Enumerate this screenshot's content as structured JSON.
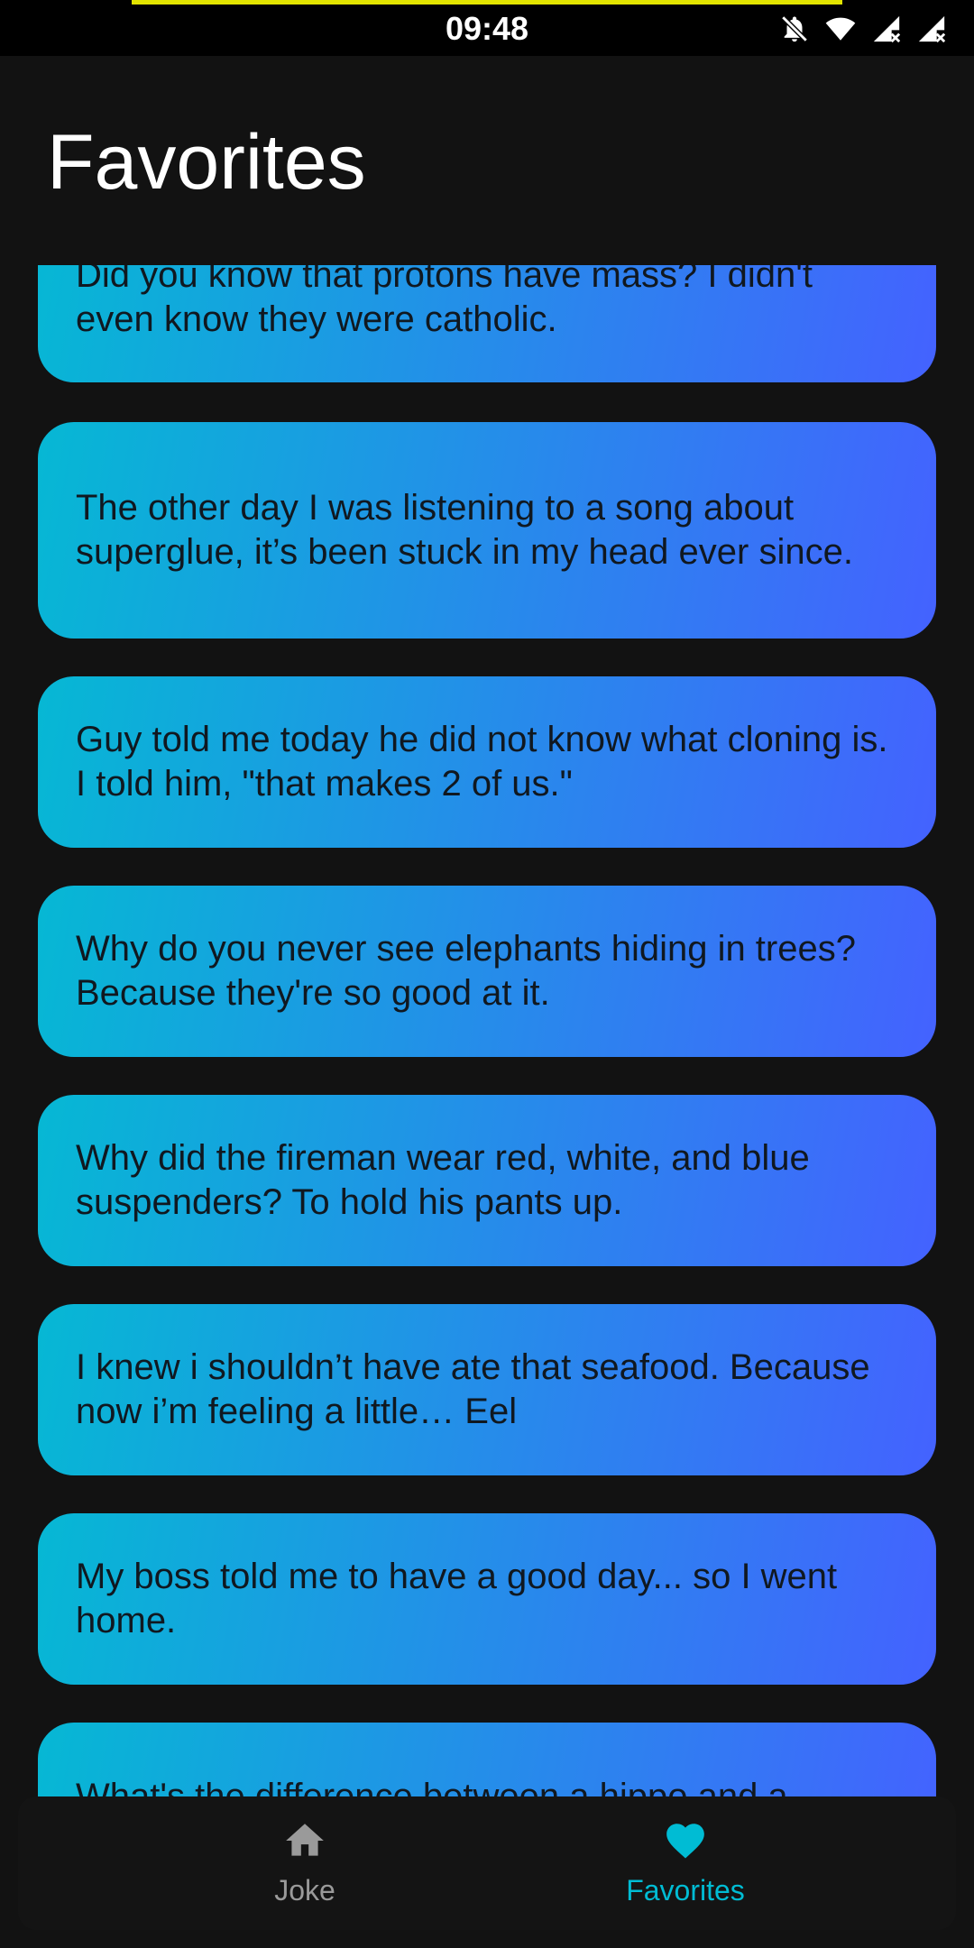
{
  "status_bar": {
    "time": "09:48",
    "icons": [
      "bell-off-icon",
      "wifi-icon",
      "signal-x-icon",
      "signal-x-icon"
    ],
    "accent_color": "#e2e400"
  },
  "header": {
    "title": "Favorites"
  },
  "theme": {
    "card_gradient_start": "#06b8d4",
    "card_gradient_end": "#4462ff",
    "background": "#121212",
    "nav_active_color": "#00bcd4",
    "nav_inactive_color": "#9a9a9a"
  },
  "favorites": [
    {
      "text": "Did you know that protons have mass? I didn't even know they were catholic."
    },
    {
      "text": "The other day I was listening to a song about superglue, it’s been stuck in my head ever since."
    },
    {
      "text": "Guy told me today he did not know what cloning is. I told him, \"that makes 2 of us.\""
    },
    {
      "text": "Why do you never see elephants hiding in trees? Because they're so good at it."
    },
    {
      "text": "Why did the fireman wear red, white, and blue suspenders? To hold his pants up."
    },
    {
      "text": "I knew i shouldn’t have ate that seafood. Because now i’m feeling a little… Eel"
    },
    {
      "text": "My boss told me to have a good day... so I went home."
    },
    {
      "text": "What's the difference between a hippo and a"
    }
  ],
  "bottom_nav": {
    "items": [
      {
        "label": "Joke",
        "icon": "home-icon",
        "active": false
      },
      {
        "label": "Favorites",
        "icon": "heart-icon",
        "active": true
      }
    ]
  }
}
